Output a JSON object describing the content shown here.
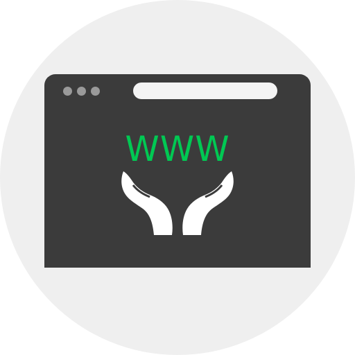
{
  "window": {
    "content_text": "WWW"
  },
  "icons": {
    "window_dots": "window-control-dots-icon",
    "address_bar": "address-bar",
    "hands": "open-hands-icon"
  },
  "colors": {
    "background_circle": "#efefef",
    "window_frame": "#3b3b3b",
    "text_accent": "#00c853",
    "hands": "#ffffff",
    "dots": "#9a9a9a",
    "address_bar": "#f4f4f4"
  }
}
